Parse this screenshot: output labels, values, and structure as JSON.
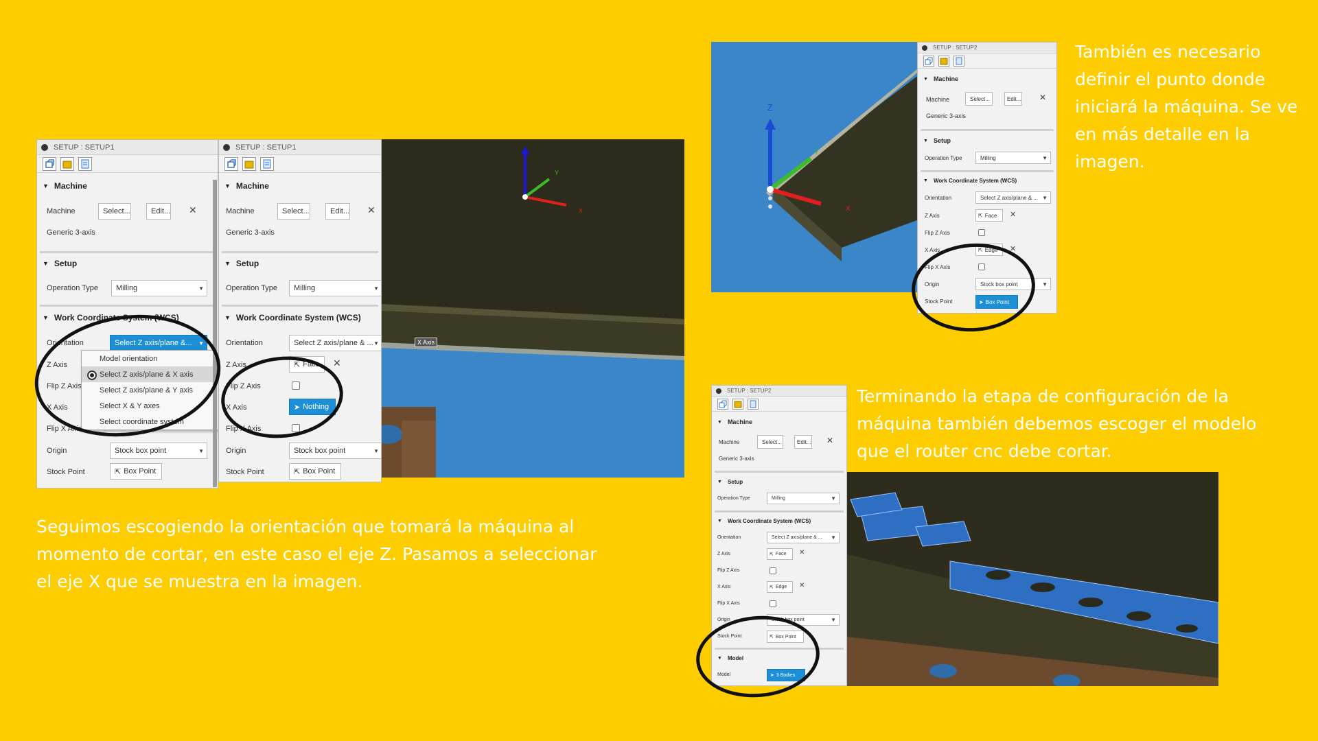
{
  "captions": {
    "left": "Seguimos escogiendo la orientación que tomará la máquina al momento de cortar, en este caso el eje Z.  Pasamos a seleccionar el eje X que se muestra en la imagen.",
    "top_right": "También es necesario definir el punto donde iniciará la máquina. Se ve en más detalle en la imagen.",
    "bottom_right": "Terminando la etapa de configuración de la máquina también debemos escoger el modelo que el router cnc debe cortar."
  },
  "panel1": {
    "title": "SETUP : SETUP1",
    "machine_section": "Machine",
    "machine_label": "Machine",
    "select_btn": "Select...",
    "edit_btn": "Edit...",
    "machine_name": "Generic 3-axis",
    "setup_section": "Setup",
    "operation_type_label": "Operation Type",
    "operation_type_value": "Milling",
    "wcs_section": "Work Coordinate System (WCS)",
    "orientation_label": "Orientation",
    "orientation_value": "Select Z axis/plane &...",
    "z_axis_label": "Z Axis",
    "flip_z_label": "Flip Z Axis",
    "x_axis_label": "X Axis",
    "flip_x_label": "Flip X Axis",
    "origin_label": "Origin",
    "origin_value": "Stock box point",
    "stock_point_label": "Stock Point",
    "stock_point_value": "Box Point",
    "dropdown": [
      "Model orientation",
      "Select Z axis/plane & X axis",
      "Select Z axis/plane & Y axis",
      "Select X & Y axes",
      "Select coordinate system"
    ],
    "dropdown_selected": "Select Z axis/plane & X axis"
  },
  "panel2": {
    "title": "SETUP : SETUP1",
    "machine_section": "Machine",
    "machine_label": "Machine",
    "select_btn": "Select...",
    "edit_btn": "Edit...",
    "machine_name": "Generic 3-axis",
    "setup_section": "Setup",
    "operation_type_label": "Operation Type",
    "operation_type_value": "Milling",
    "wcs_section": "Work Coordinate System (WCS)",
    "orientation_label": "Orientation",
    "orientation_value": "Select Z axis/plane & ...",
    "z_axis_label": "Z Axis",
    "z_axis_value": "Face",
    "flip_z_label": "Flip Z Axis",
    "x_axis_label": "X Axis",
    "x_axis_value": "Nothing",
    "flip_x_label": "Flip X Axis",
    "origin_label": "Origin",
    "origin_value": "Stock box point",
    "stock_point_label": "Stock Point",
    "stock_point_value": "Box Point"
  },
  "viewport1": {
    "x_axis_tag": "X Axis",
    "axis_y": "Y",
    "axis_x": "X"
  },
  "panel3": {
    "title": "SETUP : SETUP2",
    "machine_section": "Machine",
    "machine_label": "Machine",
    "select_btn": "Select...",
    "edit_btn": "Edit...",
    "machine_name": "Generic 3-axis",
    "setup_section": "Setup",
    "operation_type_label": "Operation Type",
    "operation_type_value": "Milling",
    "wcs_section": "Work Coordinate System (WCS)",
    "orientation_label": "Orientation",
    "orientation_value": "Select Z axis/plane & ...",
    "z_axis_label": "Z Axis",
    "z_axis_value": "Face",
    "flip_z_label": "Flip Z Axis",
    "x_axis_label": "X Axis",
    "x_axis_value": "Edge",
    "flip_x_label": "Flip X Axis",
    "origin_label": "Origin",
    "origin_value": "Stock box point",
    "stock_point_label": "Stock Point",
    "stock_point_value": "Box Point"
  },
  "viewport2": {
    "axis_z": "Z",
    "axis_y": "Y",
    "axis_x": "X"
  },
  "panel4": {
    "title": "SETUP : SETUP2",
    "machine_section": "Machine",
    "machine_label": "Machine",
    "select_btn": "Select...",
    "edit_btn": "Edit...",
    "machine_name": "Generic 3-axis",
    "setup_section": "Setup",
    "operation_type_label": "Operation Type",
    "operation_type_value": "Milling",
    "wcs_section": "Work Coordinate System (WCS)",
    "orientation_label": "Orientation",
    "orientation_value": "Select Z axis/plane & ...",
    "z_axis_label": "Z Axis",
    "z_axis_value": "Face",
    "flip_z_label": "Flip Z Axis",
    "x_axis_label": "X Axis",
    "x_axis_value": "Edge",
    "flip_x_label": "Flip X Axis",
    "origin_label": "Origin",
    "origin_value": "Stock box point",
    "stock_point_label": "Stock Point",
    "stock_point_value": "Box Point",
    "model_section": "Model",
    "model_label": "Model",
    "model_value": "3 Bodies"
  },
  "colors": {
    "background": "#FECD00",
    "accent_blue": "#1c8fd6",
    "viewport_blue": "#3a86c8",
    "stock_dark": "#3b3a22"
  },
  "icons": [
    "setup-icon",
    "stock-icon",
    "post-process-icon",
    "pointer-icon",
    "close-icon",
    "chevron-down-icon"
  ]
}
